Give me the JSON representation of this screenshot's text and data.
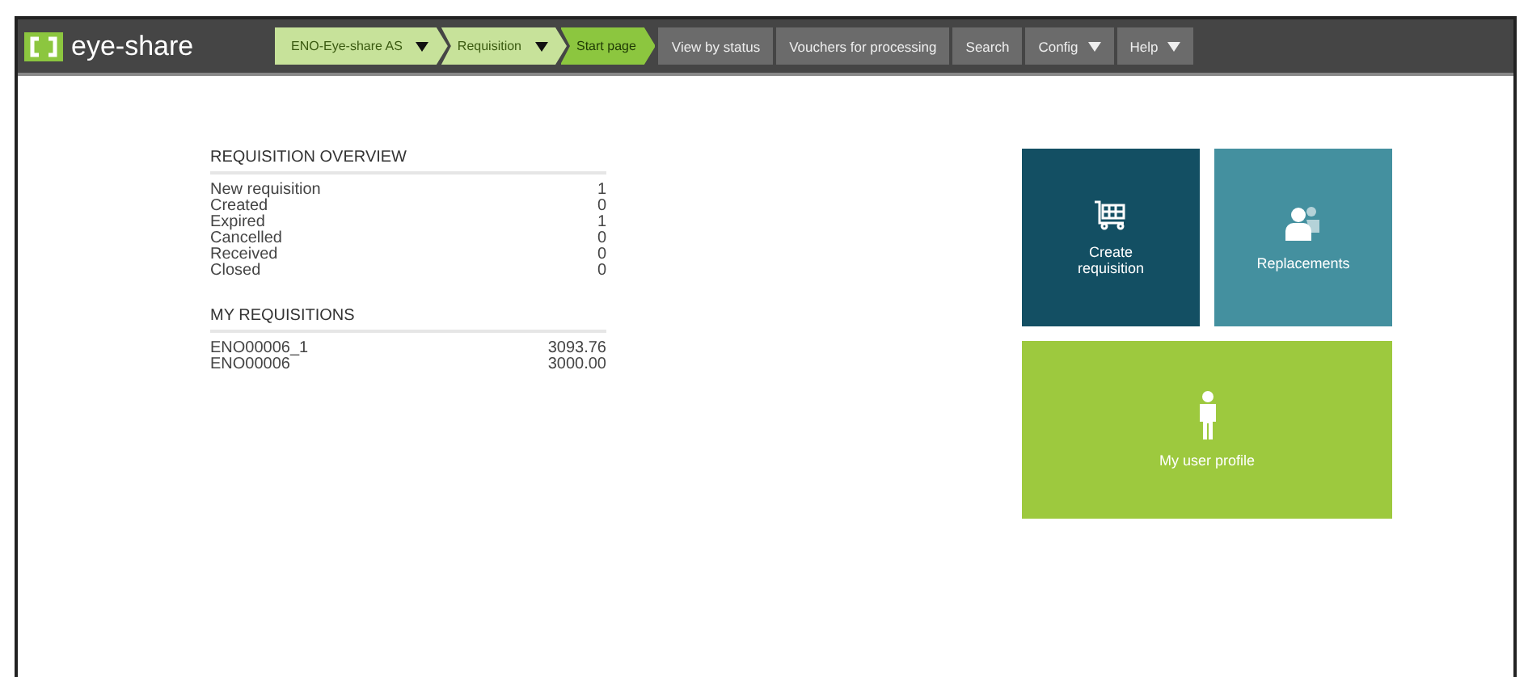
{
  "header": {
    "logo": "eye-share",
    "breadcrumbs": [
      {
        "label": "ENO-Eye-share AS",
        "dropdown": true,
        "selected": false
      },
      {
        "label": "Requisition",
        "dropdown": true,
        "selected": false
      },
      {
        "label": "Start page",
        "dropdown": false,
        "selected": true
      }
    ],
    "menu": [
      {
        "label": "View by status",
        "dropdown": false
      },
      {
        "label": "Vouchers for processing",
        "dropdown": false
      },
      {
        "label": "Search",
        "dropdown": false
      },
      {
        "label": "Config",
        "dropdown": true
      },
      {
        "label": "Help",
        "dropdown": true
      }
    ]
  },
  "requisition_overview": {
    "title": "REQUISITION OVERVIEW",
    "rows": [
      {
        "label": "New requisition",
        "value": "1"
      },
      {
        "label": "Created",
        "value": "0"
      },
      {
        "label": "Expired",
        "value": "1"
      },
      {
        "label": "Cancelled",
        "value": "0"
      },
      {
        "label": "Received",
        "value": "0"
      },
      {
        "label": "Closed",
        "value": "0"
      }
    ]
  },
  "my_requisitions": {
    "title": "MY REQUISITIONS",
    "rows": [
      {
        "label": "ENO00006_1",
        "value": "3093.76"
      },
      {
        "label": "ENO00006",
        "value": "3000.00"
      }
    ]
  },
  "tiles": [
    {
      "kind": "cart",
      "label": "Create requisition",
      "color": "#134f63"
    },
    {
      "kind": "people",
      "label": "Replacements",
      "color": "#44909f"
    },
    {
      "kind": "person",
      "label": "My user profile",
      "color": "#9dc93e"
    }
  ]
}
